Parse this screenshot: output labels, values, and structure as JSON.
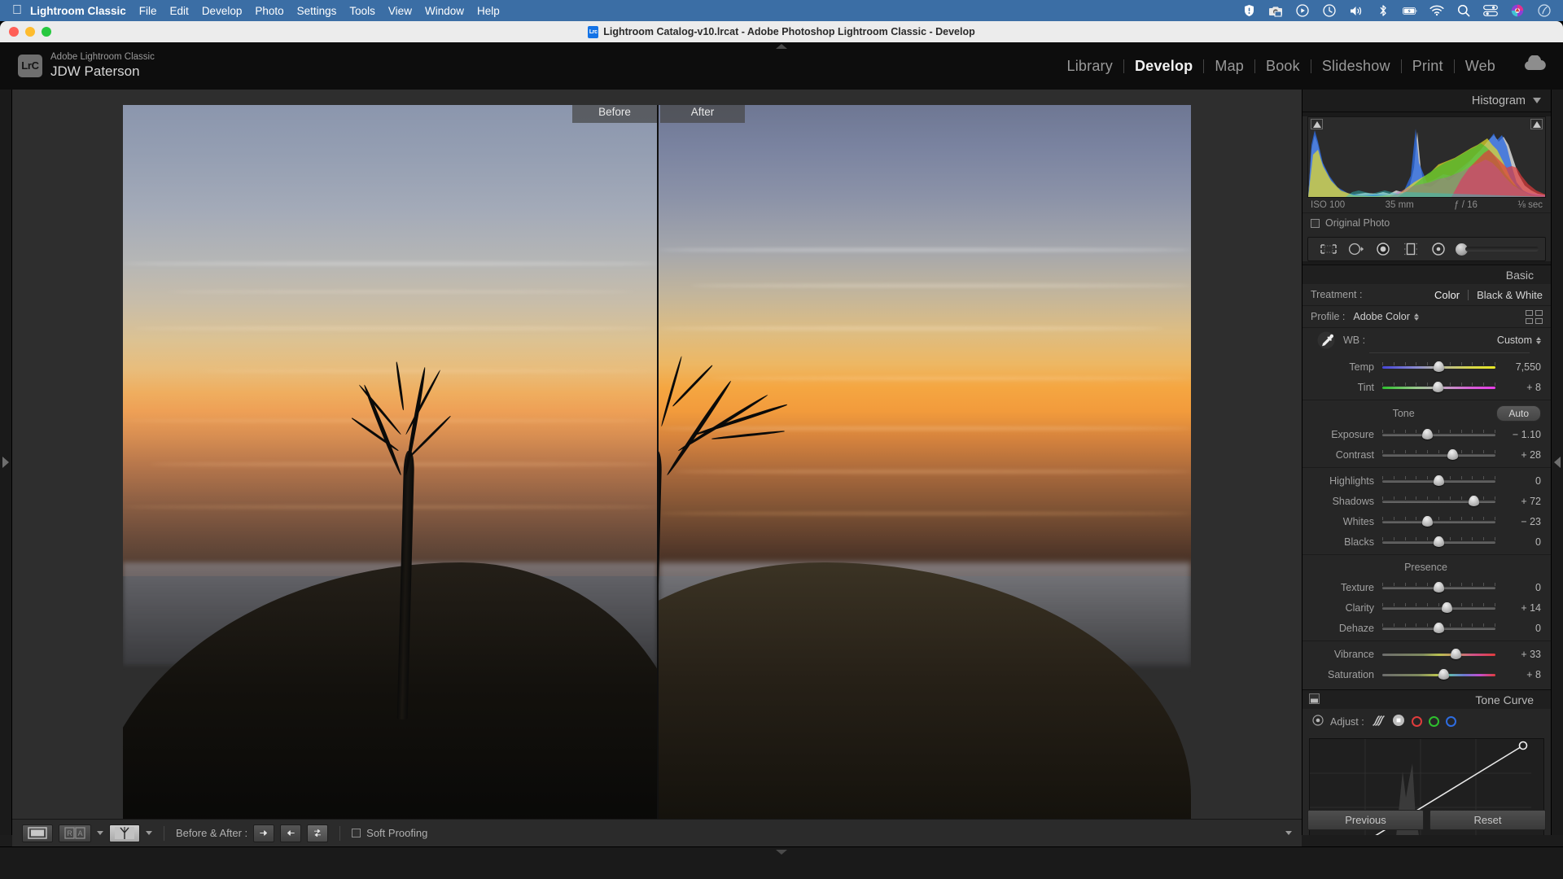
{
  "macos_menubar": {
    "apple_logo": "apple-icon",
    "app_name": "Lightroom Classic",
    "menus": [
      "File",
      "Edit",
      "Develop",
      "Photo",
      "Settings",
      "Tools",
      "View",
      "Window",
      "Help"
    ],
    "status_icons": [
      "shield-alert-icon",
      "screenshot-icon",
      "play-circle-icon",
      "time-machine-icon",
      "volume-icon",
      "bluetooth-icon",
      "battery-charging-icon",
      "wifi-icon",
      "search-icon",
      "control-center-icon",
      "user-avatar-icon",
      "siri-icon"
    ]
  },
  "window": {
    "title": "Lightroom Catalog-v10.lrcat - Adobe Photoshop Lightroom Classic - Develop",
    "file_badge": "Lrc"
  },
  "identity_plate": {
    "badge": "LrC",
    "line1": "Adobe Lightroom Classic",
    "line2": "JDW Paterson"
  },
  "modules": {
    "items": [
      {
        "label": "Library",
        "active": false
      },
      {
        "label": "Develop",
        "active": true
      },
      {
        "label": "Map",
        "active": false
      },
      {
        "label": "Book",
        "active": false
      },
      {
        "label": "Slideshow",
        "active": false
      },
      {
        "label": "Print",
        "active": false
      },
      {
        "label": "Web",
        "active": false
      }
    ],
    "cloud_icon": "cloud-sync-icon"
  },
  "image_view": {
    "mode": "Before & After",
    "before_label": "Before",
    "after_label": "After"
  },
  "histogram": {
    "title": "Histogram",
    "iso": "ISO 100",
    "focal_length": "35 mm",
    "aperture": "ƒ / 16",
    "shutter": "⅛ sec",
    "original_photo_label": "Original Photo",
    "original_photo_checked": false,
    "shadow_clip_icon": "shadow-clipping-icon",
    "highlight_clip_icon": "highlight-clipping-icon"
  },
  "tool_strip": {
    "tools": [
      "crop-overlay-icon",
      "spot-removal-icon",
      "red-eye-icon",
      "masking-icon",
      "radial-filter-icon"
    ],
    "size_slider_label": "size-slider"
  },
  "basic_panel": {
    "title": "Basic",
    "treatment_label": "Treatment :",
    "treatment_options": [
      "Color",
      "Black & White"
    ],
    "treatment_selected": "Color",
    "profile_label": "Profile :",
    "profile_value": "Adobe Color",
    "wb_label": "WB :",
    "wb_value": "Custom",
    "eyedropper_icon": "white-balance-eyedropper-icon",
    "wb_sliders": [
      {
        "name": "Temp",
        "value": "7,550",
        "pos": 50,
        "track": "temp"
      },
      {
        "name": "Tint",
        "value": "+ 8",
        "pos": 49,
        "track": "tint"
      }
    ],
    "tone_title": "Tone",
    "auto_label": "Auto",
    "tone_sliders": [
      {
        "name": "Exposure",
        "value": "− 1.10",
        "pos": 40,
        "track": ""
      },
      {
        "name": "Contrast",
        "value": "+ 28",
        "pos": 62,
        "track": ""
      }
    ],
    "tone_sliders2": [
      {
        "name": "Highlights",
        "value": "0",
        "pos": 50,
        "track": ""
      },
      {
        "name": "Shadows",
        "value": "+ 72",
        "pos": 81,
        "track": ""
      },
      {
        "name": "Whites",
        "value": "− 23",
        "pos": 40,
        "track": ""
      },
      {
        "name": "Blacks",
        "value": "0",
        "pos": 50,
        "track": ""
      }
    ],
    "presence_title": "Presence",
    "presence_sliders": [
      {
        "name": "Texture",
        "value": "0",
        "pos": 50,
        "track": ""
      },
      {
        "name": "Clarity",
        "value": "+ 14",
        "pos": 57,
        "track": ""
      },
      {
        "name": "Dehaze",
        "value": "0",
        "pos": 50,
        "track": ""
      }
    ],
    "presence_sliders2": [
      {
        "name": "Vibrance",
        "value": "+ 33",
        "pos": 65,
        "track": "vib"
      },
      {
        "name": "Saturation",
        "value": "+ 8",
        "pos": 54,
        "track": "sat"
      }
    ]
  },
  "tone_curve_panel": {
    "title": "Tone Curve",
    "adjust_label": "Adjust :",
    "target_icon": "target-adjust-icon",
    "parametric_icon": "parametric-curve-icon",
    "channels": [
      {
        "name": "rgb-channel",
        "color": "#d8d8d8"
      },
      {
        "name": "red-channel",
        "color": "#e03c3c"
      },
      {
        "name": "green-channel",
        "color": "#2ec02e"
      },
      {
        "name": "blue-channel",
        "color": "#2e6ce0"
      }
    ]
  },
  "panel_buttons": {
    "previous": "Previous",
    "reset": "Reset"
  },
  "bottom_toolbar": {
    "view_loupe_icon": "loupe-view-icon",
    "compare_label": "R A",
    "compare_icon": "compare-view-icon",
    "split_icon": "before-after-split-icon",
    "before_after_label": "Before & After :",
    "copy_after_icon": "copy-before-settings-icon",
    "copy_before_icon": "copy-after-settings-icon",
    "swap_icon": "swap-before-after-icon",
    "soft_proofing_label": "Soft Proofing",
    "soft_proofing_checked": false,
    "collapse_icon": "chevron-down-icon"
  },
  "colors": {
    "menubar_blue": "#3b6ea5",
    "panel_bg": "#262626",
    "accent_blue": "#1473e6"
  }
}
